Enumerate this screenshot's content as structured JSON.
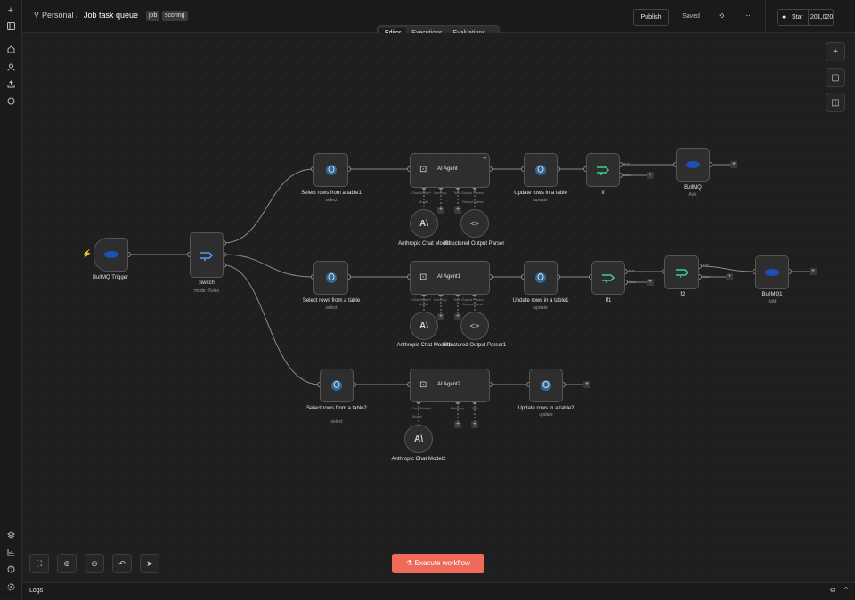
{
  "sidebar": {
    "top_icons": [
      "plus-icon",
      "panel-icon",
      "home-icon",
      "user-icon",
      "share-icon",
      "chat-icon"
    ],
    "bottom_icons": [
      "templates-icon",
      "insights-icon",
      "help-icon",
      "settings-icon"
    ]
  },
  "header": {
    "project": "Personal",
    "workflow_name": "Job task queue",
    "tags": [
      "job",
      "scoring"
    ],
    "publish": "Publish",
    "saved": "Saved",
    "star": "Star",
    "star_count": "201,020",
    "tabs": [
      "Editor",
      "Executions",
      "Evaluations"
    ]
  },
  "nodes": {
    "trigger": {
      "label": "BullMQ Trigger"
    },
    "switch": {
      "label": "Switch",
      "sub": "mode: Rules"
    },
    "sel1": {
      "label": "Select rows from a table1",
      "sub": "select"
    },
    "sel2": {
      "label": "Select rows from a table",
      "sub": "select"
    },
    "sel3": {
      "label": "Select rows from a table2",
      "sub": "select"
    },
    "agent1": {
      "label": "AI Agent",
      "ports": [
        "Chat Model*",
        "Memory",
        "Tool",
        "Output Parser"
      ],
      "model": "Model",
      "parser": "Output Parser"
    },
    "agent2": {
      "label": "AI Agent1",
      "ports": [
        "Chat Model*",
        "Memory",
        "Tool",
        "Output Parser"
      ],
      "model": "Model",
      "parser": "Output Parser"
    },
    "agent3": {
      "label": "AI Agent2",
      "ports": [
        "Chat Model*",
        "Memory",
        "Tool"
      ],
      "model": "Model"
    },
    "anth1": {
      "label": "Anthropic Chat Model"
    },
    "anth2": {
      "label": "Anthropic Chat Model1"
    },
    "anth3": {
      "label": "Anthropic Chat Model2"
    },
    "parser1": {
      "label": "Structured Output Parser"
    },
    "parser2": {
      "label": "Structured Output Parser1"
    },
    "upd1": {
      "label": "Update rows in a table",
      "sub": "update"
    },
    "upd2": {
      "label": "Update rows in a table1",
      "sub": "update"
    },
    "upd3": {
      "label": "Update rows in a table2",
      "sub": "update"
    },
    "if1": {
      "label": "If",
      "true": "true",
      "false": "false"
    },
    "if2": {
      "label": "If1",
      "true": "true",
      "false": "false"
    },
    "if3": {
      "label": "If2",
      "true": "true",
      "false": "false"
    },
    "bull1": {
      "label": "BullMQ",
      "sub": "Add"
    },
    "bull2": {
      "label": "BullMQ1",
      "sub": "Add"
    }
  },
  "execute": "Execute workflow",
  "logs": "Logs",
  "colors": {
    "accent": "#ef6a58",
    "postgres": "#336791",
    "if_green": "#3ecf8e",
    "switch_blue": "#4f9cf0",
    "bull_blue": "#1f4fb5"
  }
}
